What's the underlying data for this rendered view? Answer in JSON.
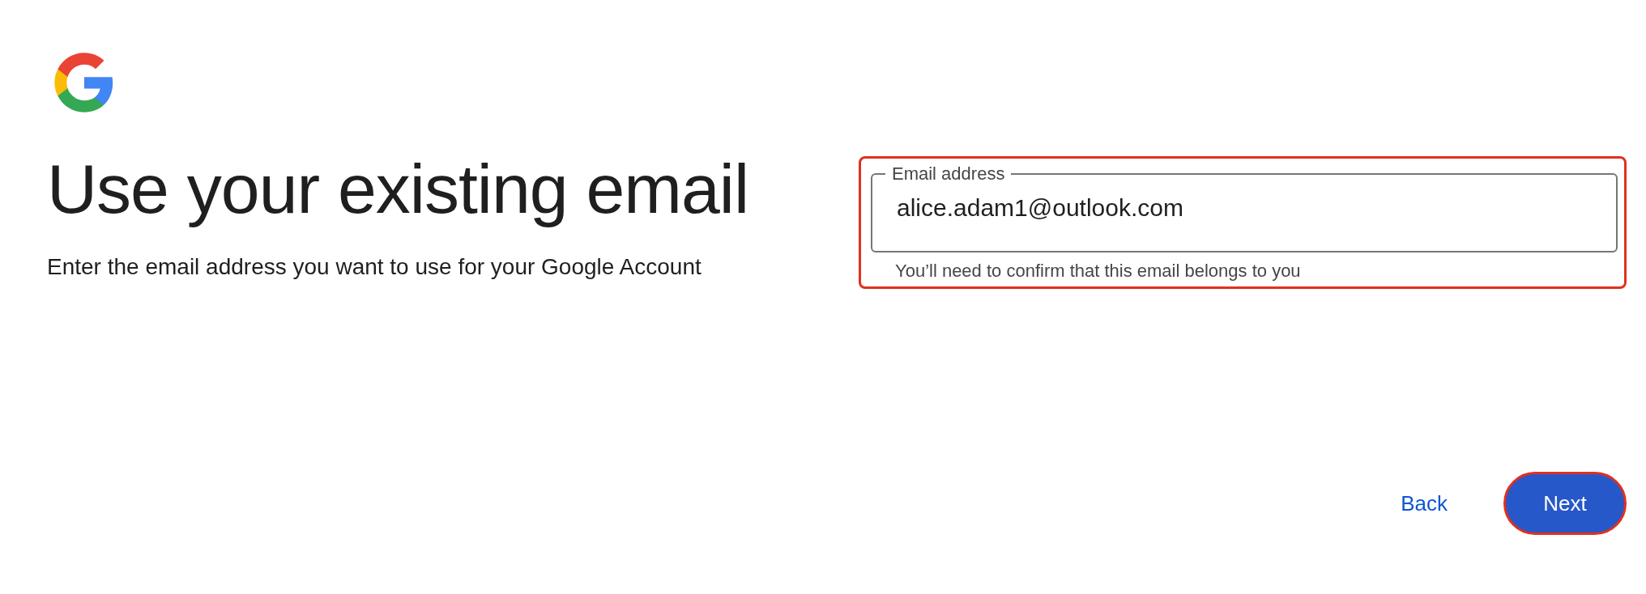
{
  "heading": "Use your existing email",
  "description": "Enter the email address you want to use for your Google Account",
  "email_field": {
    "label": "Email address",
    "value": "alice.adam1@outlook.com",
    "helper": "You’ll need to confirm that this email belongs to you",
    "highlighted": true
  },
  "buttons": [
    {
      "label": "Back",
      "kind": "text",
      "highlighted": false
    },
    {
      "label": "Next",
      "kind": "filled",
      "highlighted": true
    }
  ]
}
